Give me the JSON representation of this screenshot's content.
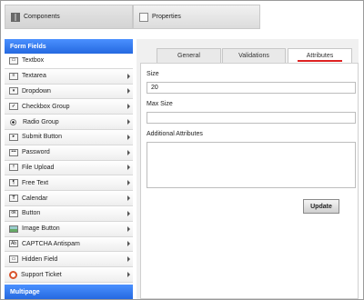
{
  "top_tabs": {
    "components": "Components",
    "properties": "Properties"
  },
  "sidebar": {
    "section_title": "Form Fields",
    "items": [
      {
        "label": "Textbox",
        "icon": "textbox-icon"
      },
      {
        "label": "Textarea",
        "icon": "textarea-icon"
      },
      {
        "label": "Dropdown",
        "icon": "dropdown-icon"
      },
      {
        "label": "Checkbox Group",
        "icon": "checkbox-icon"
      },
      {
        "label": "Radio Group",
        "icon": "radio-icon"
      },
      {
        "label": "Submit Button",
        "icon": "submit-button-icon"
      },
      {
        "label": "Password",
        "icon": "password-icon"
      },
      {
        "label": "File Upload",
        "icon": "file-upload-icon"
      },
      {
        "label": "Free Text",
        "icon": "free-text-icon"
      },
      {
        "label": "Calendar",
        "icon": "calendar-icon"
      },
      {
        "label": "Button",
        "icon": "button-icon"
      },
      {
        "label": "Image Button",
        "icon": "image-button-icon"
      },
      {
        "label": "CAPTCHA Antispam",
        "icon": "captcha-icon"
      },
      {
        "label": "Hidden Field",
        "icon": "hidden-field-icon"
      },
      {
        "label": "Support Ticket",
        "icon": "lifebuoy-icon"
      }
    ],
    "footer_section": "Multipage"
  },
  "panel": {
    "tabs": {
      "general": "General",
      "validations": "Validations",
      "attributes": "Attributes"
    },
    "fields": {
      "size_label": "Size",
      "size_value": "20",
      "maxsize_label": "Max Size",
      "maxsize_value": "",
      "attrs_label": "Additional Attributes",
      "attrs_value": ""
    },
    "update_label": "Update"
  },
  "colors": {
    "header_blue": "#2f78f0",
    "active_tab_underline": "#dd2222"
  }
}
